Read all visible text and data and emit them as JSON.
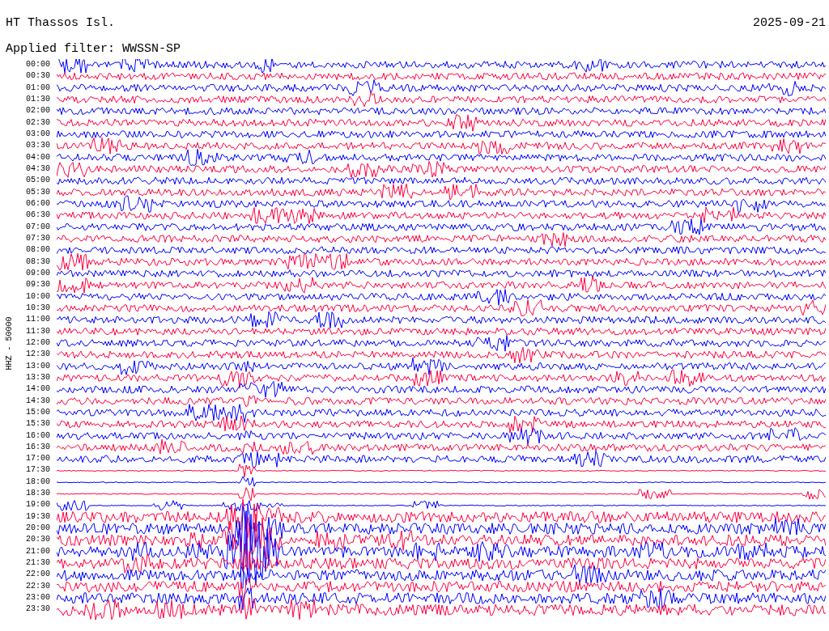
{
  "station": "HT Thassos Isl.",
  "date": "2025-09-21",
  "filter": "Applied filter: WWSSN-SP",
  "channel_label": "HHZ - 50000",
  "rows": [
    {
      "time": "00:00",
      "color": "#0000ff"
    },
    {
      "time": "00:30",
      "color": "#ff0040"
    },
    {
      "time": "01:00",
      "color": "#0000ff"
    },
    {
      "time": "01:30",
      "color": "#ff0040"
    },
    {
      "time": "02:00",
      "color": "#0000ff"
    },
    {
      "time": "02:30",
      "color": "#ff0040"
    },
    {
      "time": "03:00",
      "color": "#0000ff"
    },
    {
      "time": "03:30",
      "color": "#ff0040"
    },
    {
      "time": "04:00",
      "color": "#0000ff"
    },
    {
      "time": "04:30",
      "color": "#ff0040"
    },
    {
      "time": "05:00",
      "color": "#0000ff"
    },
    {
      "time": "05:30",
      "color": "#ff0040"
    },
    {
      "time": "06:00",
      "color": "#0000ff"
    },
    {
      "time": "06:30",
      "color": "#ff0040"
    },
    {
      "time": "07:00",
      "color": "#0000ff"
    },
    {
      "time": "07:30",
      "color": "#ff0040"
    },
    {
      "time": "08:00",
      "color": "#0000ff"
    },
    {
      "time": "08:30",
      "color": "#ff0040"
    },
    {
      "time": "09:00",
      "color": "#0000ff"
    },
    {
      "time": "09:30",
      "color": "#ff0040"
    },
    {
      "time": "10:00",
      "color": "#0000ff"
    },
    {
      "time": "10:30",
      "color": "#ff0040"
    },
    {
      "time": "11:00",
      "color": "#0000ff"
    },
    {
      "time": "11:30",
      "color": "#ff0040"
    },
    {
      "time": "12:00",
      "color": "#0000ff"
    },
    {
      "time": "12:30",
      "color": "#ff0040"
    },
    {
      "time": "13:00",
      "color": "#0000ff"
    },
    {
      "time": "13:30",
      "color": "#ff0040"
    },
    {
      "time": "14:00",
      "color": "#0000ff"
    },
    {
      "time": "14:30",
      "color": "#ff0040"
    },
    {
      "time": "15:00",
      "color": "#0000ff"
    },
    {
      "time": "15:30",
      "color": "#ff0040"
    },
    {
      "time": "16:00",
      "color": "#0000ff"
    },
    {
      "time": "16:30",
      "color": "#ff0040"
    },
    {
      "time": "17:00",
      "color": "#0000ff"
    },
    {
      "time": "17:30",
      "color": "#ff0040"
    },
    {
      "time": "18:00",
      "color": "#0000ff"
    },
    {
      "time": "18:30",
      "color": "#ff0040"
    },
    {
      "time": "19:00",
      "color": "#0000ff"
    },
    {
      "time": "19:30",
      "color": "#ff0040"
    },
    {
      "time": "20:00",
      "color": "#0000ff"
    },
    {
      "time": "20:30",
      "color": "#ff0040"
    },
    {
      "time": "21:00",
      "color": "#0000ff"
    },
    {
      "time": "21:30",
      "color": "#ff0040"
    },
    {
      "time": "22:00",
      "color": "#0000ff"
    },
    {
      "time": "22:30",
      "color": "#ff0040"
    },
    {
      "time": "23:00",
      "color": "#0000ff"
    },
    {
      "time": "23:30",
      "color": "#ff0040"
    }
  ]
}
